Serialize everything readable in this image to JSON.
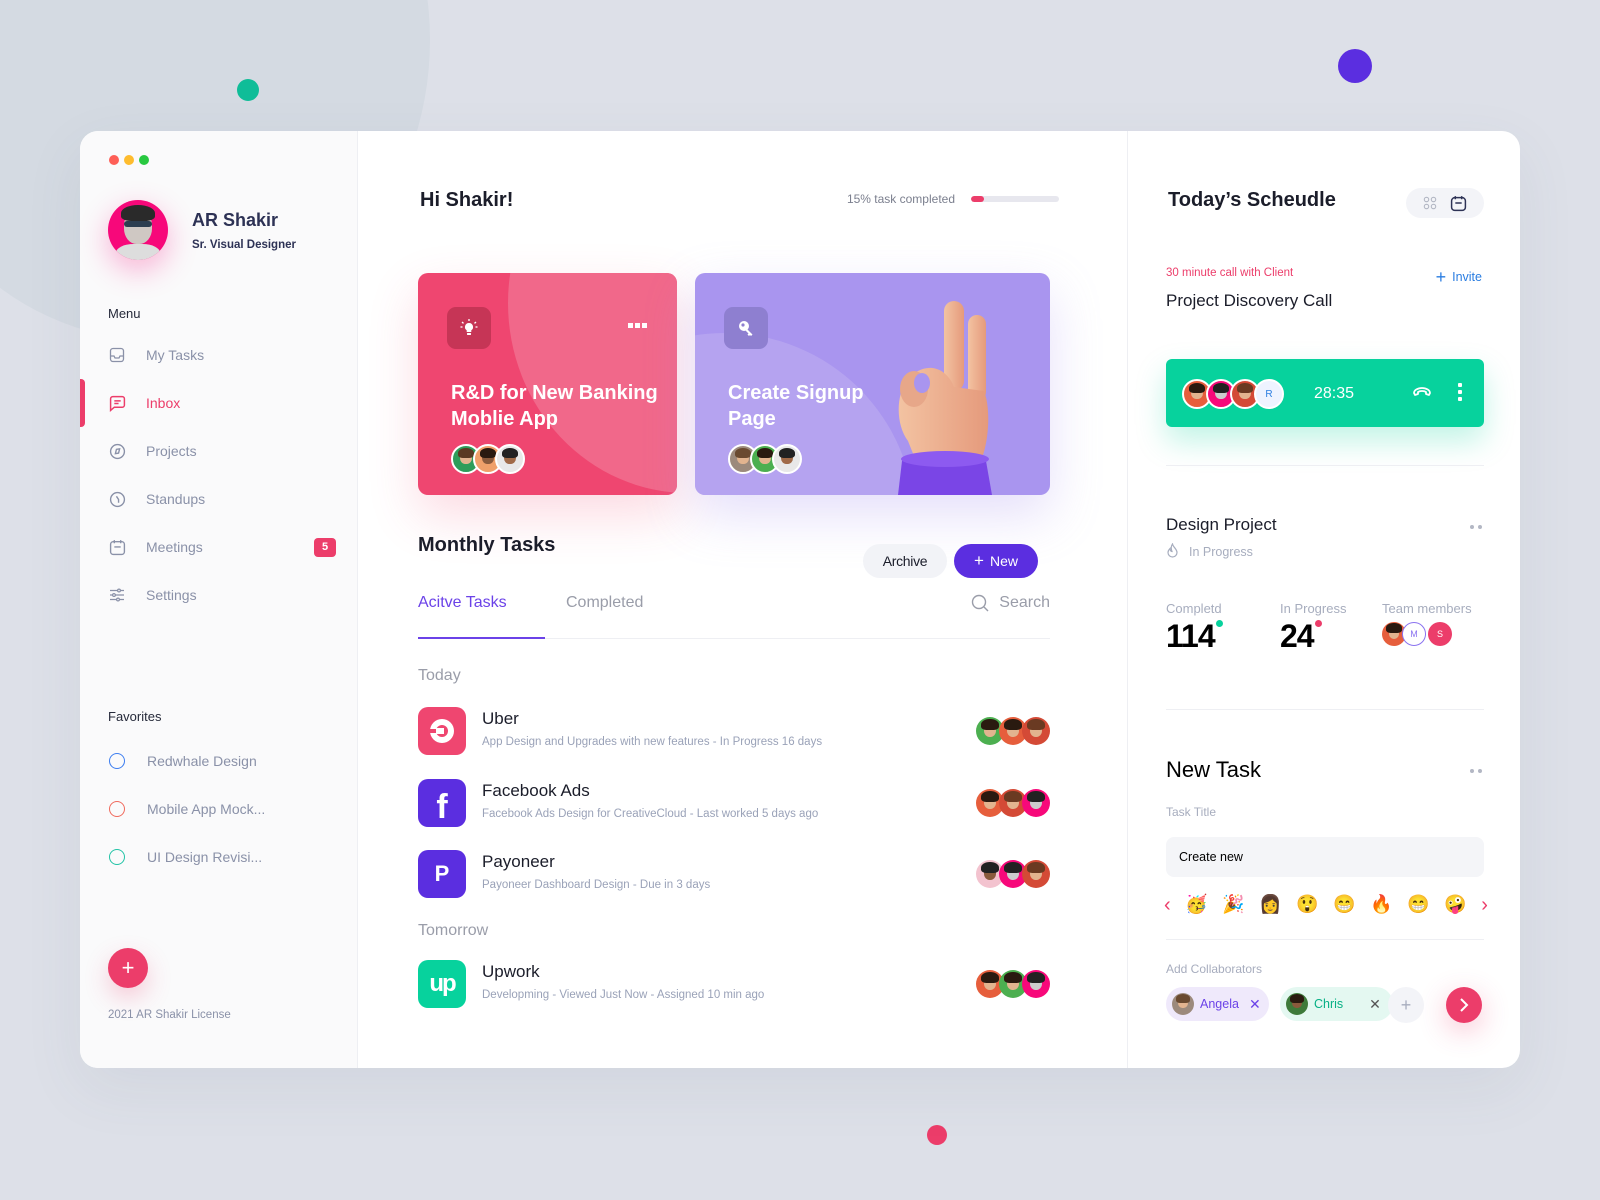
{
  "colors": {
    "accent_pink": "#ec3d6a",
    "accent_purple": "#5b2ee0",
    "accent_green": "#07d29d",
    "accent_blue": "#2a7de1",
    "decor_dot_teal": "#0fbd98",
    "decor_dot_purple": "#5b2ee0",
    "decor_dot_pink": "#ec3d6a"
  },
  "user": {
    "name": "AR Shakir",
    "role": "Sr. Visual Designer"
  },
  "sidebar": {
    "menu_title": "Menu",
    "menu": [
      {
        "label": "My Tasks",
        "icon": "inbox-tray-icon",
        "active": false
      },
      {
        "label": "Inbox",
        "icon": "chat-bubble-icon",
        "active": true
      },
      {
        "label": "Projects",
        "icon": "compass-icon",
        "active": false
      },
      {
        "label": "Standups",
        "icon": "clock-icon",
        "active": false
      },
      {
        "label": "Meetings",
        "icon": "calendar-icon",
        "active": false,
        "badge": "5"
      },
      {
        "label": "Settings",
        "icon": "sliders-icon",
        "active": false
      }
    ],
    "favorites_title": "Favorites",
    "favorites": [
      {
        "label": "Redwhale Design",
        "color": "#3f7ff0"
      },
      {
        "label": "Mobile App Mock...",
        "color": "#f06b5e"
      },
      {
        "label": "UI Design Revisi...",
        "color": "#22c3a6"
      }
    ],
    "add_label": "+",
    "license": "2021 AR Shakir License"
  },
  "main": {
    "greeting": "Hi Shakir!",
    "progress": {
      "label": "15% task completed",
      "percent": 15
    },
    "cards": [
      {
        "title": "R&D for New Banking Mobile App",
        "title_display": "R&D for New Banking Moblie App",
        "icon": "lightbulb-icon",
        "color": "#ef4670"
      },
      {
        "title": "Create Signup Page",
        "icon": "key-icon",
        "color": "#a995ef"
      }
    ],
    "section_title": "Monthly Tasks",
    "archive_label": "Archive",
    "new_label": "New",
    "tabs": [
      {
        "label": "Acitve Tasks",
        "active": true
      },
      {
        "label": "Completed",
        "active": false
      }
    ],
    "search_placeholder": "Search",
    "groups": [
      {
        "label": "Today",
        "tasks": [
          {
            "name": "Uber",
            "desc": "App Design and Upgrades with new features - In Progress 16 days",
            "logo": "uber-logo-icon",
            "logo_color": "#ef4670"
          },
          {
            "name": "Facebook Ads",
            "desc": "Facebook Ads Design for CreativeCloud - Last worked 5 days ago",
            "logo": "facebook-logo-icon",
            "logo_color": "#5b2ee0"
          },
          {
            "name": "Payoneer",
            "desc": "Payoneer Dashboard Design - Due in 3 days",
            "logo": "payoneer-logo-icon",
            "logo_color": "#5b2ee0"
          }
        ]
      },
      {
        "label": "Tomorrow",
        "tasks": [
          {
            "name": "Upwork",
            "desc": "Developming - Viewed Just Now - Assigned 10 min ago",
            "logo": "upwork-logo-icon",
            "logo_color": "#07d29d"
          }
        ]
      }
    ]
  },
  "schedule": {
    "title": "Today’s Scheudle",
    "call_subtitle": "30 minute call with Client",
    "call_title": "Project Discovery Call",
    "invite_label": "Invite",
    "call_timer": "28:35",
    "call_extra_participant": "R",
    "project": {
      "title": "Design Project",
      "status": "In Progress",
      "stats": [
        {
          "label": "Completd",
          "value": "114",
          "dot": "#07d29d"
        },
        {
          "label": "In Progress",
          "value": "24",
          "dot": "#ec3d6a"
        }
      ],
      "team_label": "Team members",
      "team_initials": [
        "M",
        "S"
      ]
    },
    "new_task": {
      "title": "New Task",
      "field_label": "Task Title",
      "field_value": "Create new",
      "emojis": [
        "🥳",
        "🎉",
        "👩",
        "😲",
        "😁",
        "🔥",
        "😁",
        "🤪"
      ],
      "collab_label": "Add Collaborators",
      "collaborators": [
        {
          "name": "Angela",
          "bg": "#efe9fb",
          "color": "#6b42e8"
        },
        {
          "name": "Chris",
          "bg": "#e4f8f1",
          "color": "#07b085"
        }
      ]
    }
  }
}
